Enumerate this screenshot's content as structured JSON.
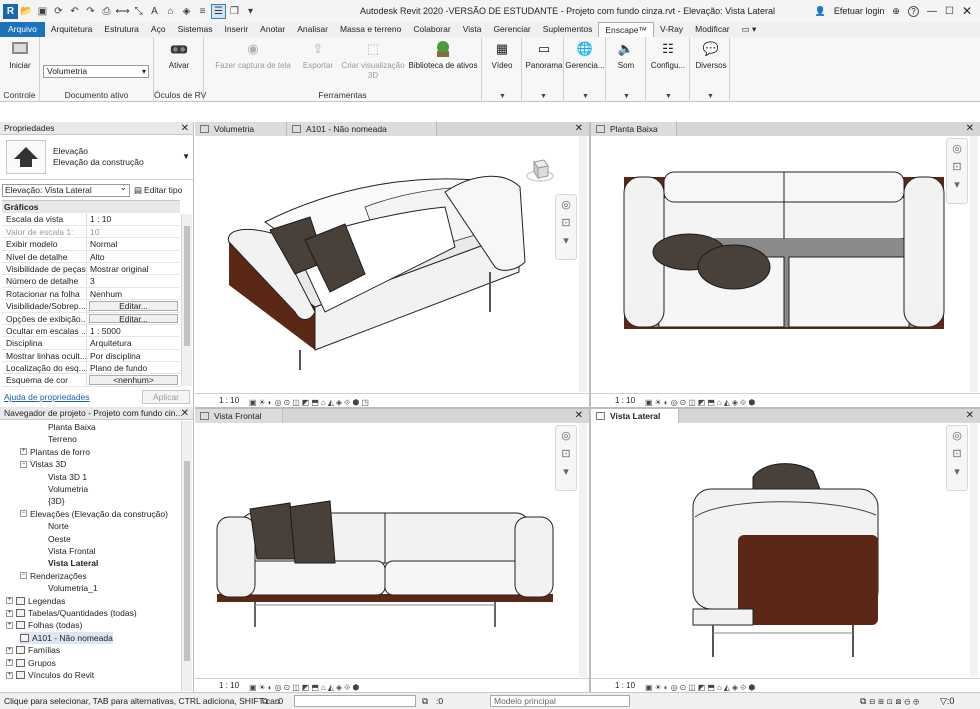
{
  "app": {
    "title": "Autodesk Revit 2020 -VERSÃO DE ESTUDANTE - Projeto com fundo cinza.rvt - Elevação: Vista Lateral",
    "login": "Efetuar login",
    "help": "?"
  },
  "ribbon_tabs": [
    "Arquivo",
    "Arquitetura",
    "Estrutura",
    "Aço",
    "Sistemas",
    "Inserir",
    "Anotar",
    "Analisar",
    "Massa e terreno",
    "Colaborar",
    "Vista",
    "Gerenciar",
    "Suplementos",
    "Enscape™",
    "V-Ray",
    "Modificar"
  ],
  "active_tab": "Enscape™",
  "ribbon": {
    "iniciar": "Iniciar",
    "controle": "Controle",
    "doc_select": "Volumetria",
    "doc_label": "Documento ativo",
    "ativar": "Ativar",
    "vr_label": "Óculos de RV",
    "fazer_captura": "Fazer captura de tela",
    "exportar": "Exportar",
    "criar_visualizacao": "Criar visualização 3D",
    "biblioteca": "Biblioteca de ativos",
    "ferramentas": "Ferramentas",
    "video": "Vídeo",
    "panorama": "Panorama",
    "gerencia": "Gerencia...",
    "som": "Som",
    "configu": "Configu...",
    "diversos": "Diversos"
  },
  "properties": {
    "title": "Propriedades",
    "type_line1": "Elevação",
    "type_line2": "Elevação da construção",
    "selector": "Elevação: Vista Lateral",
    "edit_type": "Editar tipo",
    "section": "Gráficos",
    "rows": [
      {
        "name": "Escala da vista",
        "value": "1 : 10"
      },
      {
        "name": "Valor de escala    1:",
        "value": "10"
      },
      {
        "name": "Exibir modelo",
        "value": "Normal"
      },
      {
        "name": "Nível de detalhe",
        "value": "Alto"
      },
      {
        "name": "Visibilidade de peças",
        "value": "Mostrar original"
      },
      {
        "name": "Número de detalhe",
        "value": "3"
      },
      {
        "name": "Rotacionar na folha",
        "value": "Nenhum"
      },
      {
        "name": "Visibilidade/Sobrep...",
        "value": "Editar..."
      },
      {
        "name": "Opções de exibição...",
        "value": "Editar..."
      },
      {
        "name": "Ocultar em escalas ...",
        "value": "1 : 5000"
      },
      {
        "name": "Disciplina",
        "value": "Arquitetura"
      },
      {
        "name": "Mostrar linhas ocult...",
        "value": "Por disciplina"
      },
      {
        "name": "Localização do esq...",
        "value": "Plano de fundo"
      },
      {
        "name": "Esquema de cor",
        "value": "<nenhum>"
      }
    ],
    "help_link": "Ajuda de propriedades",
    "apply": "Aplicar"
  },
  "browser": {
    "title": "Navegador de projeto - Projeto com fundo cin...",
    "items": [
      "Planta Baixa",
      "Terreno",
      "Plantas de forro",
      "Vistas 3D",
      "Vista 3D 1",
      "Volumetria",
      "{3D}",
      "Elevações (Elevação da construção)",
      "Norte",
      "Oeste",
      "Vista Frontal",
      "Vista Lateral",
      "Renderizações",
      "Volumetria_1",
      "Legendas",
      "Tabelas/Quantidades (todas)",
      "Folhas (todas)",
      "A101 - Não nomeada",
      "Famílias",
      "Grupos",
      "Vínculos do Revit"
    ]
  },
  "views": {
    "tab_volumetria": "Volumetria",
    "tab_a101": "A101 - Não nomeada",
    "tab_planta": "Planta Baixa",
    "tab_frontal": "Vista Frontal",
    "tab_lateral": "Vista Lateral",
    "scale": "1 : 10"
  },
  "status": {
    "text": "Clique para selecionar, TAB para alternativas, CTRL adiciona, SHIFT can",
    "workset": ":0",
    "model": "Modelo principal",
    "sel_count": ":0"
  },
  "colors": {
    "file_tab": "#1c73b9",
    "cushion": "#4a403a",
    "leather": "#5a2814",
    "fabric": "#f2f2f2"
  }
}
